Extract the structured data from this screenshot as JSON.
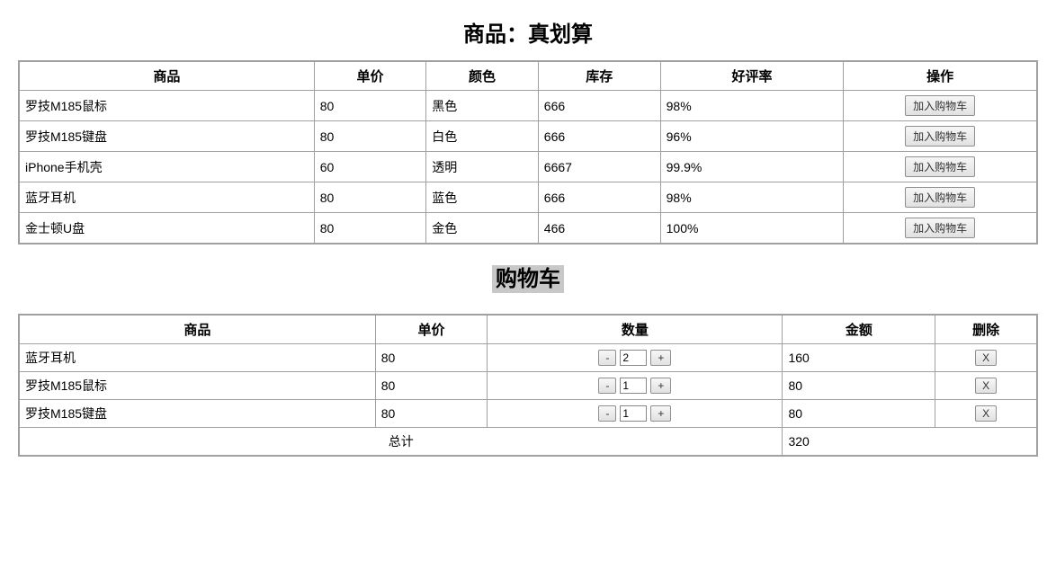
{
  "products_title": "商品：真划算",
  "products_headers": {
    "name": "商品",
    "price": "单价",
    "color": "颜色",
    "stock": "库存",
    "rating": "好评率",
    "action": "操作"
  },
  "add_to_cart_label": "加入购物车",
  "products": [
    {
      "name": "罗技M185鼠标",
      "price": "80",
      "color": "黑色",
      "stock": "666",
      "rating": "98%"
    },
    {
      "name": "罗技M185键盘",
      "price": "80",
      "color": "白色",
      "stock": "666",
      "rating": "96%"
    },
    {
      "name": "iPhone手机壳",
      "price": "60",
      "color": "透明",
      "stock": "6667",
      "rating": "99.9%"
    },
    {
      "name": "蓝牙耳机",
      "price": "80",
      "color": "蓝色",
      "stock": "666",
      "rating": "98%"
    },
    {
      "name": "金士顿U盘",
      "price": "80",
      "color": "金色",
      "stock": "466",
      "rating": "100%"
    }
  ],
  "cart_title": "购物车",
  "cart_headers": {
    "name": "商品",
    "price": "单价",
    "qty": "数量",
    "amount": "金额",
    "delete": "删除"
  },
  "stepper_minus": "-",
  "stepper_plus": "+",
  "delete_label": "X",
  "cart_items": [
    {
      "name": "蓝牙耳机",
      "price": "80",
      "qty": "2",
      "amount": "160"
    },
    {
      "name": "罗技M185鼠标",
      "price": "80",
      "qty": "1",
      "amount": "80"
    },
    {
      "name": "罗技M185键盘",
      "price": "80",
      "qty": "1",
      "amount": "80"
    }
  ],
  "total_label": "总计",
  "total_value": "320"
}
